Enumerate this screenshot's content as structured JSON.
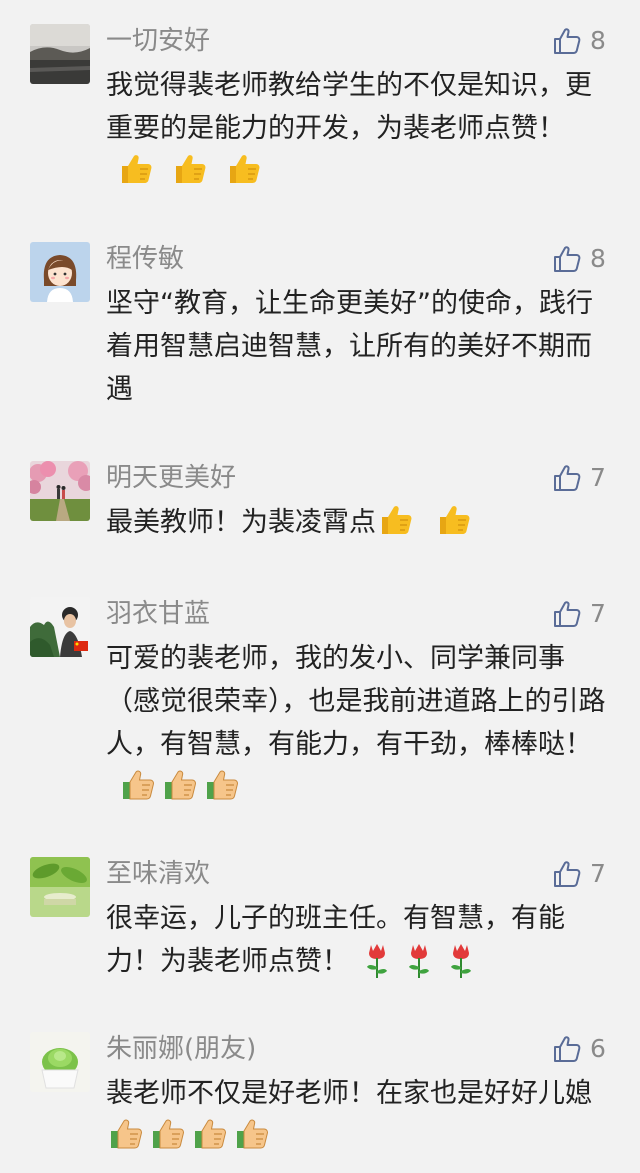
{
  "comments": [
    {
      "nickname": "一切安好",
      "likes": "8",
      "text": "我觉得裴老师教给学生的不仅是知识，更重要的是能力的开发，为裴老师点赞！",
      "emoji": [
        "thumbs-up",
        "thumbs-up",
        "thumbs-up"
      ]
    },
    {
      "nickname": "程传敏",
      "likes": "8",
      "text": "坚守“教育，让生命更美好”的使命，践行着用智慧启迪智慧，让所有的美好不期而遇",
      "emoji": []
    },
    {
      "nickname": "明天更美好",
      "likes": "7",
      "text": "最美教师！为裴凌霄点",
      "emoji": [
        "thumbs-up",
        "thumbs-up"
      ]
    },
    {
      "nickname": "羽衣甘蓝",
      "likes": "7",
      "text": "可爱的裴老师，我的发小、同学兼同事（感觉很荣幸），也是我前进道路上的引路人，有智慧，有能力，有干劲，棒棒哒！",
      "emoji": [
        "thumbs-up-light",
        "thumbs-up-light",
        "thumbs-up-light"
      ]
    },
    {
      "nickname": "至味清欢",
      "likes": "7",
      "text": "很幸运，儿子的班主任。有智慧，有能力！为裴老师点赞！",
      "emoji": [
        "rose",
        "rose",
        "rose"
      ]
    },
    {
      "nickname": "朱丽娜(朋友)",
      "likes": "6",
      "text": "裴老师不仅是好老师！在家也是好好儿媳",
      "emoji": [
        "thumbs-up-light",
        "thumbs-up-light",
        "thumbs-up-light",
        "thumbs-up-light"
      ]
    }
  ],
  "colors": {
    "background": "#f2f2f2",
    "nickname": "#8a8a8a",
    "text": "#222222",
    "like_icon": "#5a6c97",
    "thumb_yellow": "#f5b81c",
    "rose_red": "#e23a3a"
  }
}
